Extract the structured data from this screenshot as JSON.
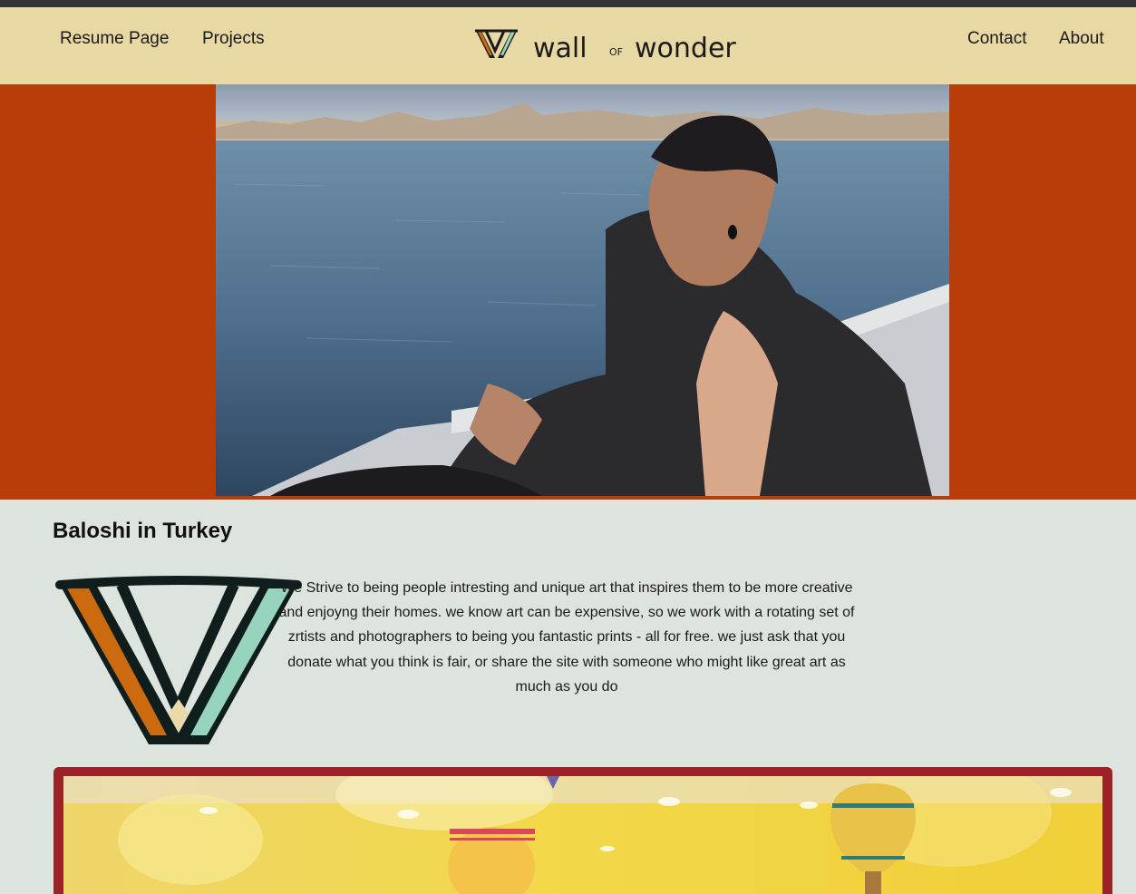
{
  "nav": {
    "left": [
      "Resume Page",
      "Projects"
    ],
    "right": [
      "Contact",
      "About"
    ]
  },
  "brand": {
    "name_part1": "wall",
    "name_connector": "OF",
    "name_part2": "wonder"
  },
  "post": {
    "title": "Baloshi in Turkey",
    "intro": "We Strive to being people intresting and unique art that inspires them to be more creative and enjoyng their homes. we know art can be expensive, so we work with a rotating set of zrtists and photographers to being you fantastic prints - all for free. we just ask that you donate what you think is fair, or share the site with someone who might like great art as much as you do"
  },
  "colors": {
    "header_bg": "#e8d8a4",
    "hero_bg": "#b83d08",
    "page_bg": "#dce4dd",
    "frame": "#9b2226",
    "logo_orange": "#cc6a10",
    "logo_teal": "#96d4bd",
    "logo_cream": "#ecd9a8"
  },
  "icons": {
    "brand_logo": "wall-of-wonder-logo",
    "hero_image": "man-on-ferry-istanbul-photo",
    "gallery_image": "hot-air-balloons-photo"
  }
}
